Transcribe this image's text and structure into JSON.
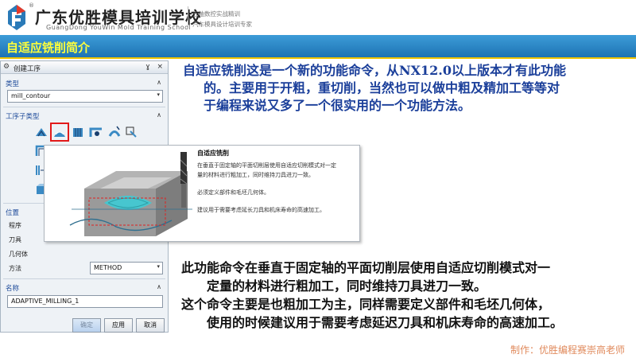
{
  "header": {
    "school_cn": "广东优胜模具培训学校",
    "school_en": "GuangDong YouWin Mold Training School",
    "slogan_1": "五轴数控实战精训",
    "slogan_2": "汽车模具设计培训专家",
    "registered_mark": "®"
  },
  "title_bar": {
    "title": "自适应铣削简介"
  },
  "dialog": {
    "title": "创建工序",
    "title_buttons": "ɣ ×",
    "type_section": "类型",
    "type_value": "mill_contour",
    "subtype_section": "工序子类型",
    "location_section": "位置",
    "location_rows": [
      {
        "label": "程序"
      },
      {
        "label": "刀具"
      },
      {
        "label": "几何体"
      },
      {
        "label": "方法",
        "value": "METHOD"
      }
    ],
    "name_section": "名称",
    "name_value": "ADAPTIVE_MILLING_1",
    "buttons": {
      "ok": "确定",
      "apply": "应用",
      "cancel": "取消"
    }
  },
  "tooltip": {
    "title": "自适应铣削",
    "lines": [
      "在垂直于固定轴的平面切削层使用自适应切削模式对一定",
      "量的材料进行粗加工，同时维持刀具进刀一致。",
      "必须定义部件和毛坯几何体。",
      "建议用于需要考虑延长刀具和机床寿命的高速加工。"
    ]
  },
  "paragraphs": {
    "intro": [
      "自适应铣削这是一个新的功能命令，从NX12.0以上版本才有此功能",
      "的。主要用于开粗，重切削，当然也可以做中粗及精加工等等对",
      "于编程来说又多了一个很实用的一个功能方法。"
    ],
    "detail": [
      "此功能命令在垂直于固定轴的平面切削层使用自适应切削模式对一",
      "定量的材料进行粗加工，同时维持刀具进刀一致。",
      "这个命令主要是也粗加工为主，同样需要定义部件和毛坯几何体，",
      "使用的时候建议用于需要考虑延迟刀具和机床寿命的高速加工。"
    ]
  },
  "footer": {
    "credit": "制作：优胜编程赛崇高老师"
  },
  "colors": {
    "title_bar": "#1d73b3",
    "title_text": "#ffff3a",
    "accent_line": "#f0c400",
    "body_text": "#1b3f9a",
    "footer": "#e08a5c",
    "selection": "#e21a1a"
  }
}
